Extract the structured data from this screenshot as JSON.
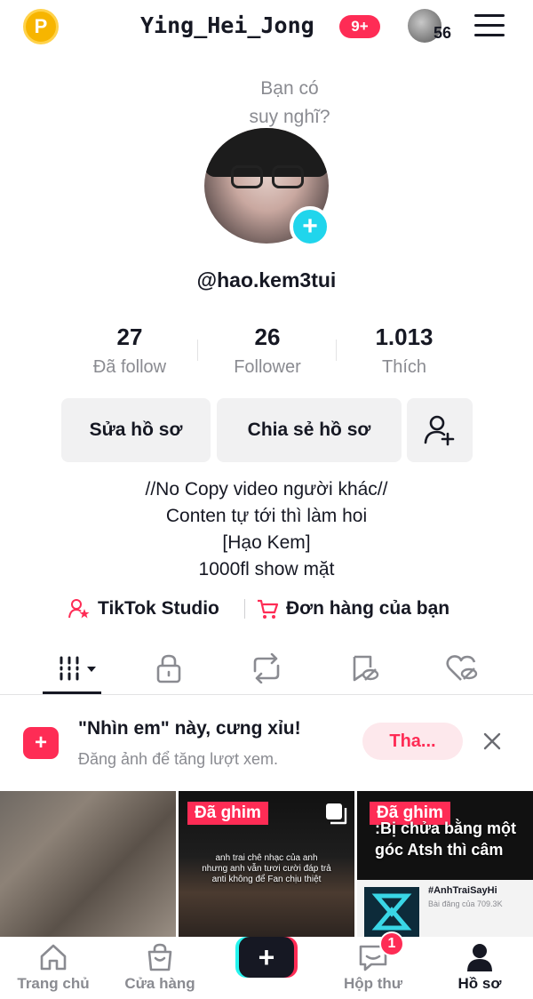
{
  "header": {
    "coin_label": "P",
    "username": "Ying_Hei_Jong",
    "notification_badge": "9+",
    "account_count": "56"
  },
  "profile": {
    "thought_prompt_line1": "Bạn có",
    "thought_prompt_line2": "suy nghĩ?",
    "add_icon": "+",
    "handle": "@hao.kem3tui",
    "stats": [
      {
        "value": "27",
        "label": "Đã follow"
      },
      {
        "value": "26",
        "label": "Follower"
      },
      {
        "value": "1.013",
        "label": "Thích"
      }
    ],
    "edit_button": "Sửa hồ sơ",
    "share_button": "Chia sẻ hồ sơ",
    "add_friend_icon": "add-friend-icon",
    "bio": [
      "//No Copy video người khác//",
      "Conten tự tới thì làm hoi",
      "[Hạo Kem]",
      "1000fl show mặt"
    ],
    "links": {
      "studio": "TikTok Studio",
      "orders": "Đơn hàng của bạn"
    }
  },
  "tabs": [
    "videos-grid-icon",
    "lock-icon",
    "repost-icon",
    "favorites-icon",
    "liked-icon"
  ],
  "promo": {
    "title": "\"Nhìn em\" này, cưng xỉu!",
    "subtitle": "Đăng ảnh để tăng lượt xem.",
    "button": "Tha..."
  },
  "grid": {
    "pinned_label": "Đã ghim",
    "cell2_caption_line1": "anh trai chê nhạc của anh",
    "cell2_caption_line2": "nhưng anh vẫn tươi cười đáp trả",
    "cell2_caption_line3": "anti không để Fan chịu thiệt",
    "cell3_caption_line1": ":Bị chửa bằng một",
    "cell3_caption_line2": "góc Atsh thì câm",
    "cell3_hashtag": "#AnhTraiSayHi",
    "cell3_views": "Bài đăng của 709.3K"
  },
  "bottom_nav": {
    "home": "Trang chủ",
    "shop": "Cửa hàng",
    "create": "+",
    "inbox": "Hộp thư",
    "inbox_badge": "1",
    "profile": "Hồ sơ"
  },
  "colors": {
    "accent": "#fe2c55",
    "cyan": "#25f4ee",
    "text": "#161823",
    "muted": "#8a8b91"
  }
}
